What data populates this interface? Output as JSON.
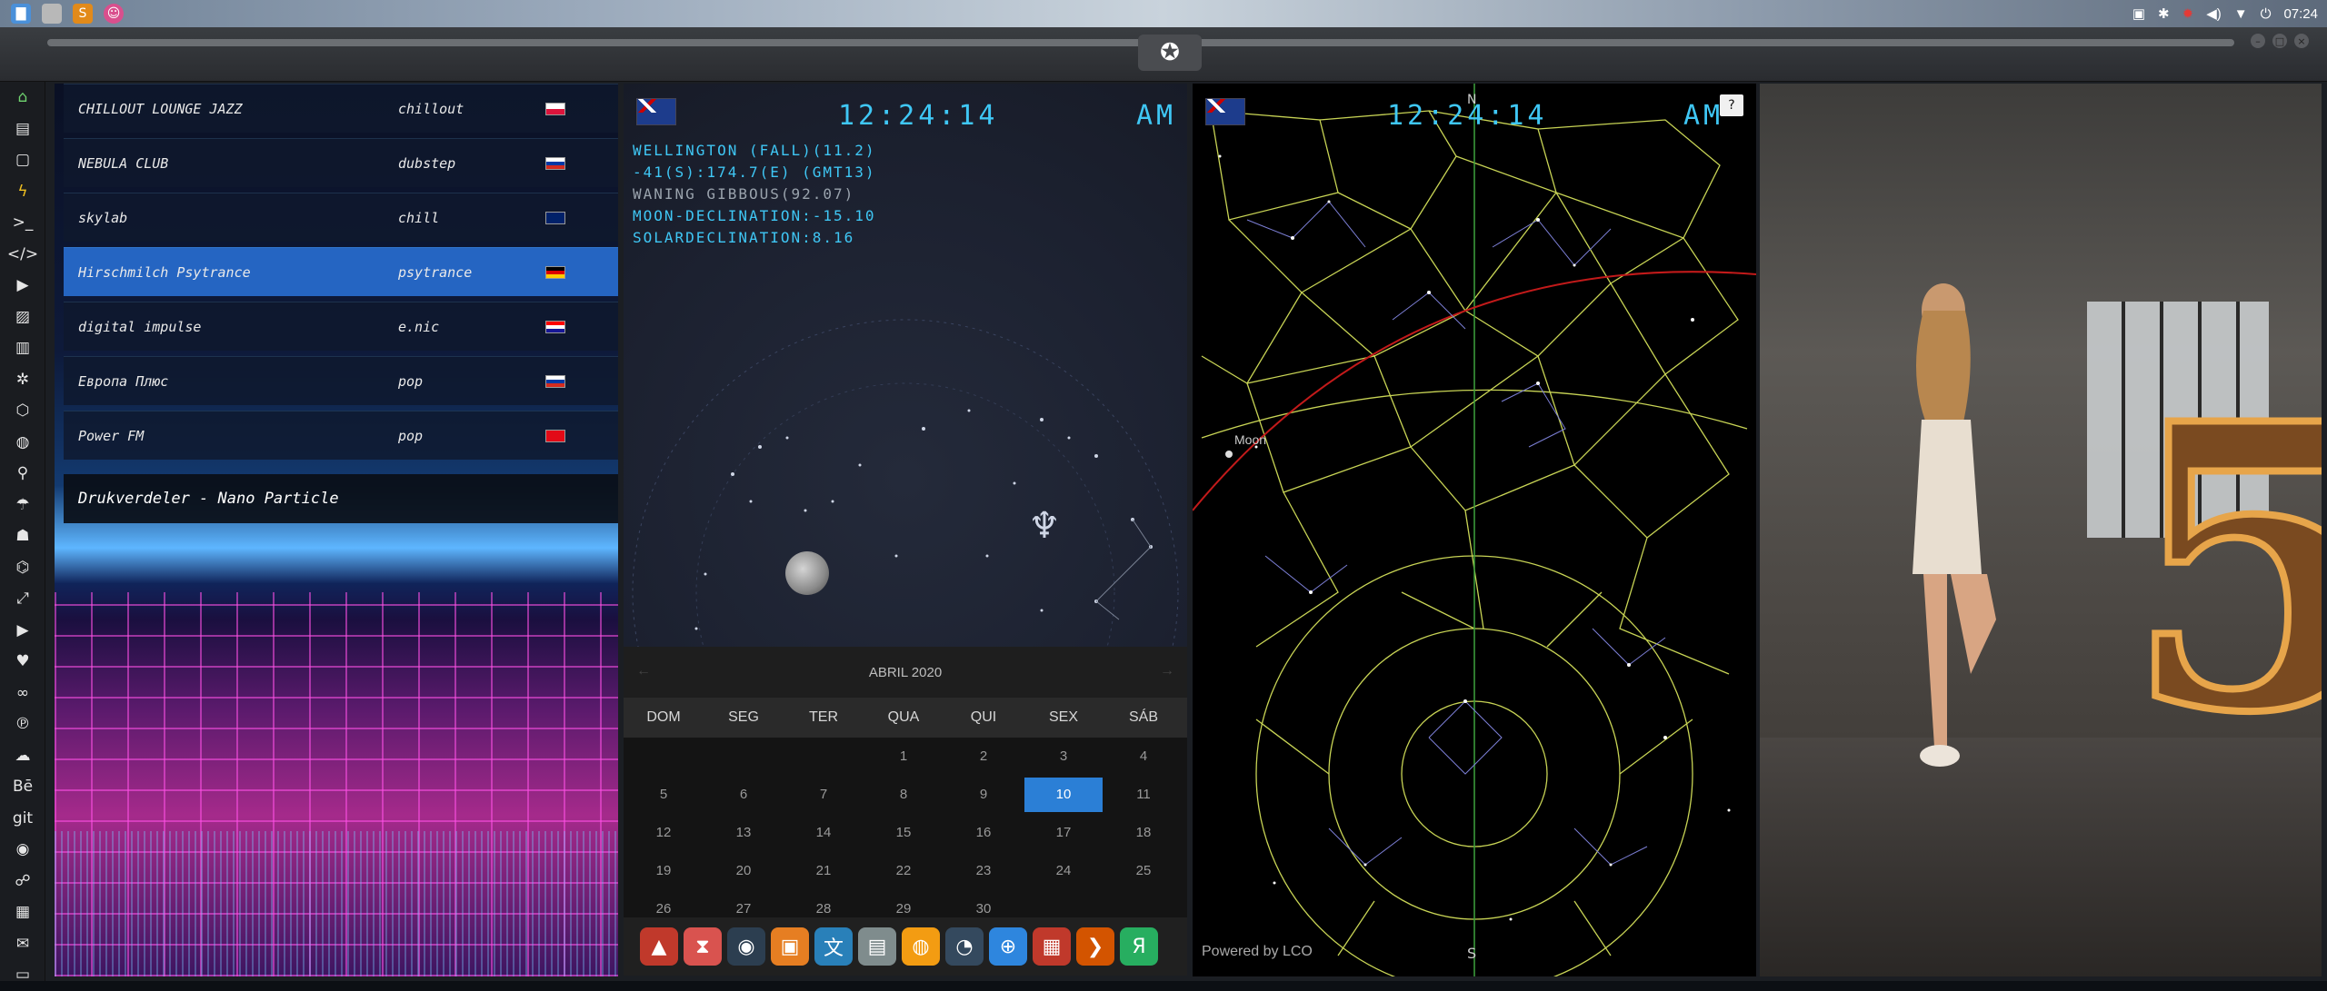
{
  "system_bar": {
    "time": "07:24",
    "tray_icons": [
      "screenshot-icon",
      "bluetooth-icon",
      "gear-icon",
      "volume-icon",
      "wifi-icon",
      "power-icon"
    ]
  },
  "sidebar": {
    "items": [
      "home",
      "document",
      "file",
      "bolt",
      "terminal",
      "code",
      "play",
      "image",
      "book",
      "gear",
      "hexagon",
      "globe",
      "search",
      "umbrella",
      "person",
      "tag",
      "expand",
      "youtube",
      "heart",
      "infinity",
      "pinterest",
      "cloud",
      "Bē",
      "git",
      "github",
      "users",
      "map",
      "mail",
      "window"
    ]
  },
  "radio": {
    "stations": [
      {
        "name": "CHILLOUT LOUNGE JAZZ",
        "genre": "chillout",
        "flag": "pl"
      },
      {
        "name": "NEBULA CLUB",
        "genre": "dubstep",
        "flag": "ru"
      },
      {
        "name": "skylab",
        "genre": "chill",
        "flag": "gb"
      },
      {
        "name": "Hirschmilch Psytrance",
        "genre": "psytrance",
        "flag": "de"
      },
      {
        "name": "digital impulse",
        "genre": "e.nic",
        "flag": "hr"
      },
      {
        "name": "Европа Плюс",
        "genre": "pop",
        "flag": "ru"
      },
      {
        "name": "Power FM",
        "genre": "pop",
        "flag": "tr"
      }
    ],
    "selected_index": 3,
    "now_playing": "Drukverdeler - Nano Particle"
  },
  "clock": {
    "time": "12:24:14",
    "ampm": "AM",
    "info_lines": [
      "WELLINGTON (FALL)(11.2)",
      "-41(S):174.7(E) (GMT13)",
      "WANING GIBBOUS(92.07)",
      "MOON-DECLINATION:-15.10",
      "SOLARDECLINATION:8.16"
    ]
  },
  "calendar": {
    "month_label": "ABRIL 2020",
    "days_of_week": [
      "DOM",
      "SEG",
      "TER",
      "QUA",
      "QUI",
      "SEX",
      "SÁB"
    ],
    "weeks": [
      [
        "",
        "",
        "",
        "1",
        "2",
        "3",
        "4"
      ],
      [
        "5",
        "6",
        "7",
        "8",
        "9",
        "10",
        "11"
      ],
      [
        "12",
        "13",
        "14",
        "15",
        "16",
        "17",
        "18"
      ],
      [
        "19",
        "20",
        "21",
        "22",
        "23",
        "24",
        "25"
      ],
      [
        "26",
        "27",
        "28",
        "29",
        "30",
        "",
        ""
      ]
    ],
    "today": "10"
  },
  "dock": {
    "apps": [
      {
        "name": "app-a-icon",
        "color": "#c0392b",
        "glyph": "▲"
      },
      {
        "name": "hourglass-icon",
        "color": "#d9534f",
        "glyph": "⧗"
      },
      {
        "name": "globe-dark-icon",
        "color": "#2c3e50",
        "glyph": "◉"
      },
      {
        "name": "image-viewer-icon",
        "color": "#e67e22",
        "glyph": "▣"
      },
      {
        "name": "translate-icon",
        "color": "#2980b9",
        "glyph": "文"
      },
      {
        "name": "calendar-mini-icon",
        "color": "#7f8c8d",
        "glyph": "▤"
      },
      {
        "name": "search-app-icon",
        "color": "#f39c12",
        "glyph": "◍"
      },
      {
        "name": "clock-app-icon",
        "color": "#34495e",
        "glyph": "◔"
      },
      {
        "name": "web-globe-icon",
        "color": "#2e86de",
        "glyph": "⊕"
      },
      {
        "name": "calendar-app-icon",
        "color": "#c0392b",
        "glyph": "▦"
      },
      {
        "name": "arrow-app-icon",
        "color": "#d35400",
        "glyph": "❯"
      },
      {
        "name": "yandex-icon",
        "color": "#27ae60",
        "glyph": "Я"
      }
    ]
  },
  "skymap": {
    "time": "12:24:14",
    "ampm": "AM",
    "north_label": "N",
    "south_label": "S",
    "moon_label": "Moon",
    "help_label": "?",
    "powered_by": "Powered by LCO"
  }
}
